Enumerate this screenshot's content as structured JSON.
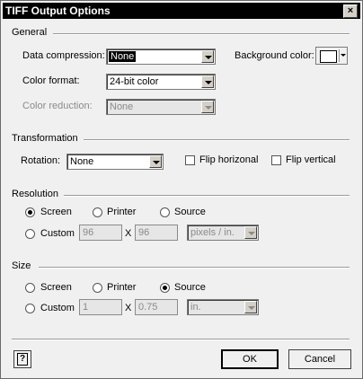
{
  "window": {
    "title": "TIFF Output Options",
    "close_glyph": "×"
  },
  "general": {
    "title": "General",
    "data_compression": {
      "label": "Data compression:",
      "value": "None"
    },
    "background_color": {
      "label": "Background color:",
      "swatch_color": "#ffffff"
    },
    "color_format": {
      "label": "Color format:",
      "value": "24-bit color"
    },
    "color_reduction": {
      "label": "Color reduction:",
      "value": "None"
    }
  },
  "transformation": {
    "title": "Transformation",
    "rotation": {
      "label": "Rotation:",
      "value": "None"
    },
    "flip_horizontal": {
      "label": "Flip horizonal",
      "checked": false
    },
    "flip_vertical": {
      "label": "Flip vertical",
      "checked": false
    }
  },
  "resolution": {
    "title": "Resolution",
    "options": {
      "screen": "Screen",
      "printer": "Printer",
      "source": "Source",
      "custom": "Custom"
    },
    "selected": "screen",
    "custom_x": "96",
    "x_sep": "X",
    "custom_y": "96",
    "units": "pixels / in."
  },
  "size": {
    "title": "Size",
    "options": {
      "screen": "Screen",
      "printer": "Printer",
      "source": "Source",
      "custom": "Custom"
    },
    "selected": "source",
    "custom_x": "1",
    "x_sep": "X",
    "custom_y": "0.75",
    "units": "in."
  },
  "footer": {
    "help_glyph": "?",
    "ok_label": "OK",
    "cancel_label": "Cancel"
  }
}
